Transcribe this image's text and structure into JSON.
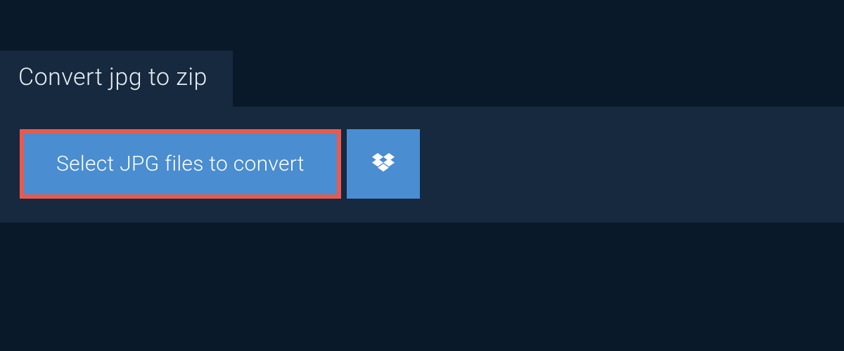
{
  "tab": {
    "title": "Convert jpg to zip"
  },
  "actions": {
    "select_label": "Select JPG files to convert"
  },
  "colors": {
    "background": "#0a1929",
    "panel": "#16293f",
    "button": "#4a8dd0",
    "highlight_border": "#e85a4f"
  }
}
